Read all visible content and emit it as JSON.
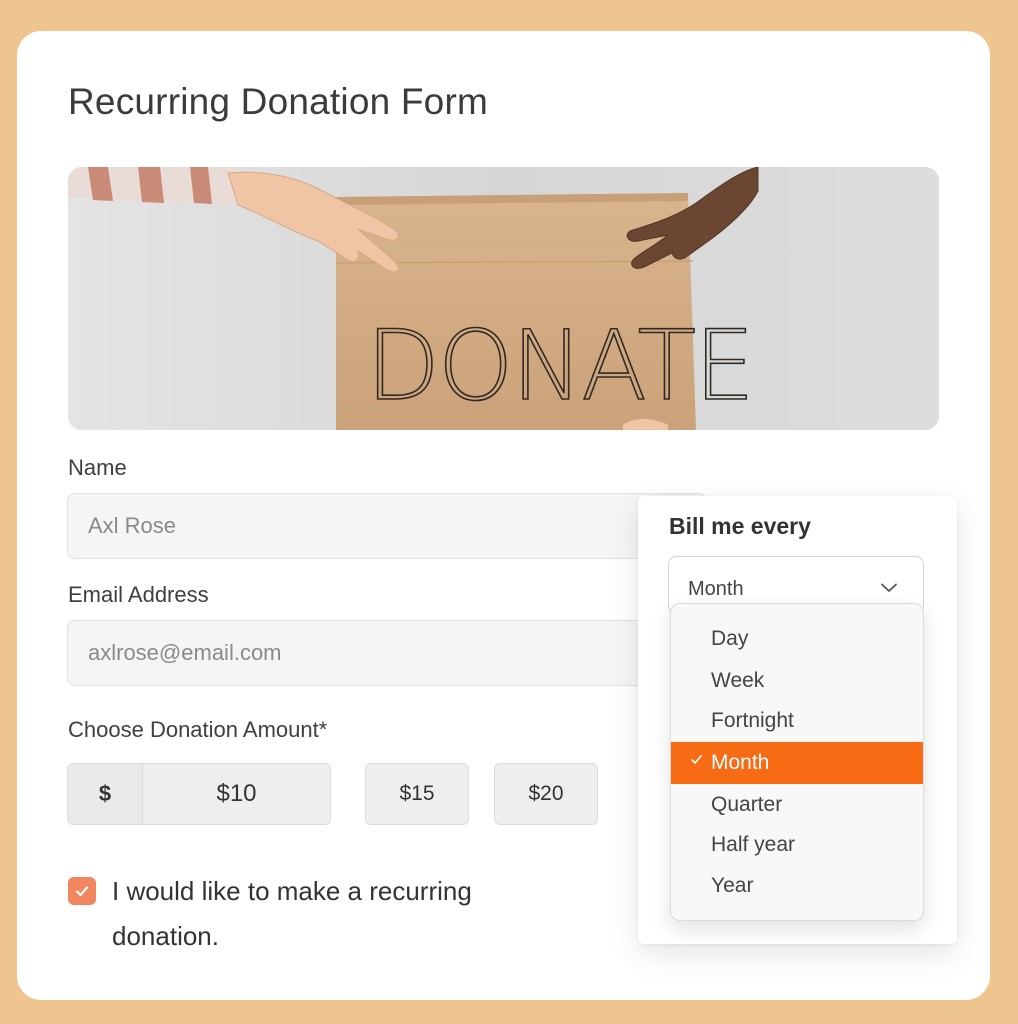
{
  "form": {
    "title": "Recurring Donation Form",
    "hero_sign_text": "DONATE",
    "name": {
      "label": "Name",
      "placeholder": "Axl Rose"
    },
    "email": {
      "label": "Email Address",
      "placeholder": "axlrose@email.com"
    },
    "amount": {
      "label": "Choose Donation Amount*",
      "currency_symbol": "$",
      "value": "$10",
      "presets": [
        "$15",
        "$20"
      ]
    },
    "recurring": {
      "checked": true,
      "label": "I would like to make a recurring donation."
    }
  },
  "billing": {
    "title": "Bill me every",
    "selected": "Month",
    "options": [
      "Day",
      "Week",
      "Fortnight",
      "Month",
      "Quarter",
      "Half year",
      "Year"
    ]
  },
  "colors": {
    "page_background": "#eec48f",
    "accent_orange": "#f76b15",
    "checkbox": "#f2865e"
  }
}
